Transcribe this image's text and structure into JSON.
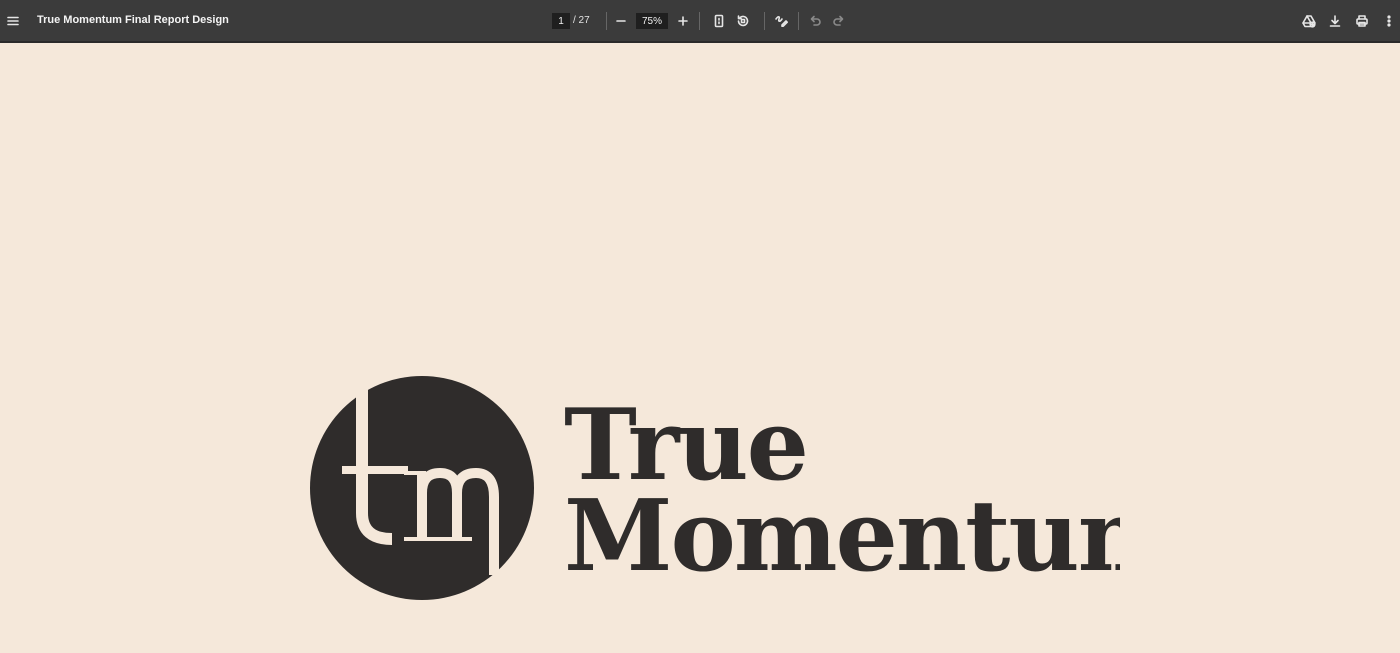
{
  "toolbar": {
    "title": "True Momentum Final Report Design",
    "page_current": "1",
    "page_total": "/ 27",
    "zoom": "75%"
  },
  "logo": {
    "monogram": "tm",
    "line1": "True",
    "line2": "Momentum"
  },
  "colors": {
    "toolbar_bg": "#3b3b3b",
    "page_bg": "#f5e8da",
    "logo_dark": "#2f2c2b"
  }
}
